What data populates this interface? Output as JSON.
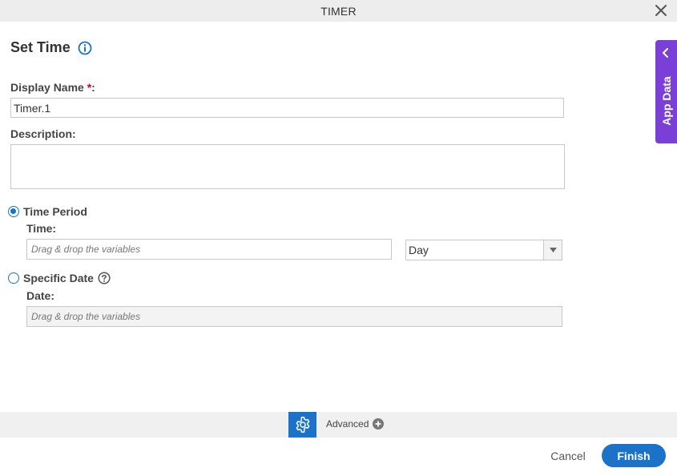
{
  "dialog": {
    "title": "TIMER"
  },
  "section": {
    "heading": "Set Time"
  },
  "display_name": {
    "label": "Display Name",
    "required_mark": "*",
    "colon": ":",
    "value": "Timer.1"
  },
  "description": {
    "label": "Description:",
    "value": ""
  },
  "time_period": {
    "label": "Time Period",
    "selected": true,
    "time_label": "Time:",
    "time_placeholder": "Drag & drop the variables",
    "unit_value": "Day"
  },
  "specific_date": {
    "label": "Specific Date",
    "selected": false,
    "date_label": "Date:",
    "date_placeholder": "Drag & drop the variables"
  },
  "side_panel": {
    "label": "App Data"
  },
  "footer": {
    "advanced_label": "Advanced",
    "cancel_label": "Cancel",
    "finish_label": "Finish"
  },
  "colors": {
    "accent": "#1a73c9",
    "side_panel": "#7a3fd6",
    "required": "#d0021b"
  },
  "icons": [
    "close-icon",
    "info-icon",
    "help-icon",
    "chevron-left-icon",
    "gear-icon",
    "plus-circle-icon",
    "dropdown-arrow-icon"
  ]
}
